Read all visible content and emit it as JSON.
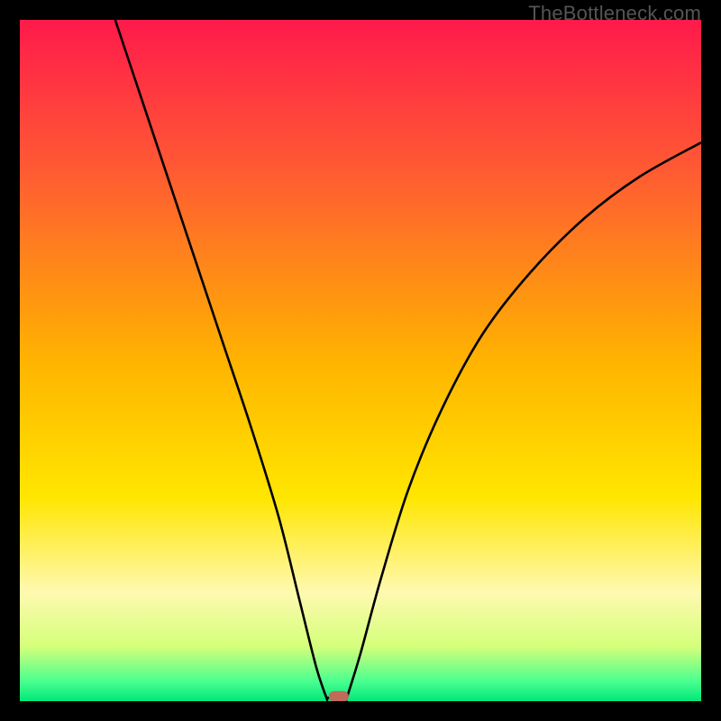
{
  "watermark": "TheBottleneck.com",
  "chart_data": {
    "type": "line",
    "title": "",
    "xlabel": "",
    "ylabel": "",
    "xlim": [
      0,
      100
    ],
    "ylim": [
      0,
      100
    ],
    "gradient_stops": [
      {
        "pos": 0.0,
        "color": "#ff1a4b"
      },
      {
        "pos": 0.22,
        "color": "#ff5a33"
      },
      {
        "pos": 0.5,
        "color": "#ffb300"
      },
      {
        "pos": 0.7,
        "color": "#ffe600"
      },
      {
        "pos": 0.84,
        "color": "#fff9b0"
      },
      {
        "pos": 0.92,
        "color": "#d4ff7a"
      },
      {
        "pos": 0.97,
        "color": "#4cff8f"
      },
      {
        "pos": 1.0,
        "color": "#00e87a"
      }
    ],
    "series": [
      {
        "name": "left-branch",
        "x": [
          14.0,
          18.0,
          22.0,
          26.0,
          30.0,
          34.0,
          38.0,
          41.0,
          43.5,
          45.0
        ],
        "y": [
          100.0,
          88.0,
          76.0,
          64.0,
          52.0,
          40.0,
          27.0,
          15.0,
          5.0,
          0.5
        ]
      },
      {
        "name": "right-branch",
        "x": [
          48.0,
          50.0,
          53.0,
          57.0,
          62.0,
          68.0,
          75.0,
          83.0,
          91.0,
          100.0
        ],
        "y": [
          0.5,
          7.0,
          18.0,
          31.0,
          43.0,
          54.0,
          63.0,
          71.0,
          77.0,
          82.0
        ]
      },
      {
        "name": "valley-floor",
        "x": [
          45.0,
          48.0
        ],
        "y": [
          0.5,
          0.5
        ]
      }
    ],
    "marker": {
      "x": 46.8,
      "y": 0.7,
      "color": "#c06a5a"
    }
  }
}
